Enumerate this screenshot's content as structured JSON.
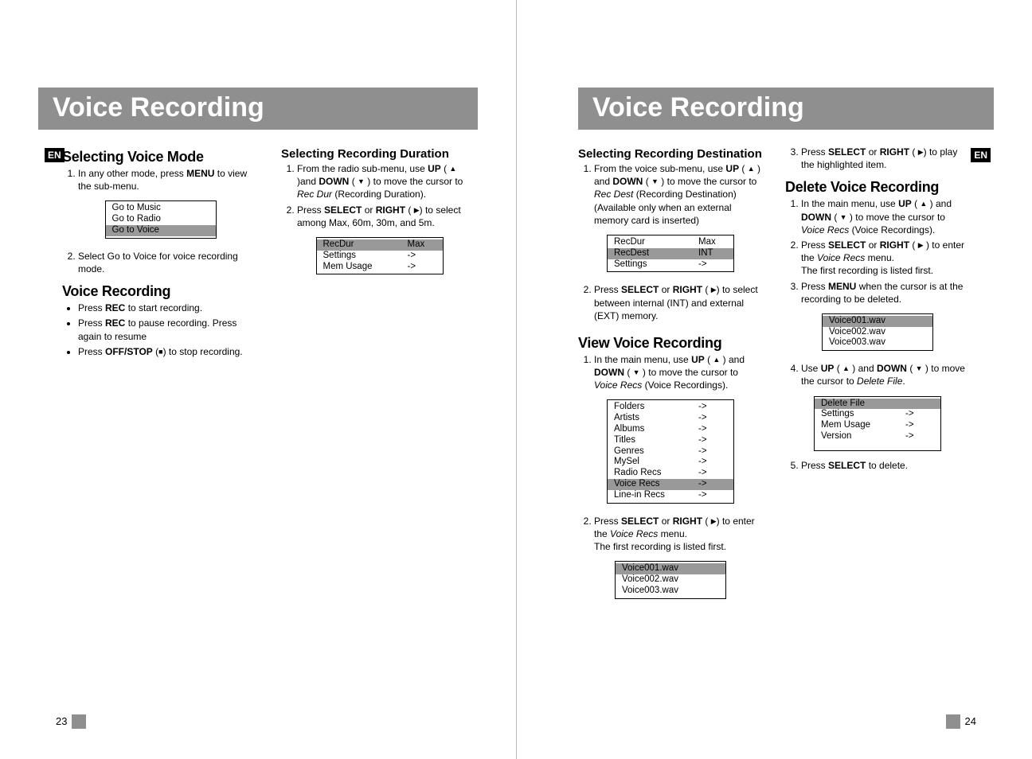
{
  "lang": "EN",
  "left": {
    "banner": "Voice Recording",
    "col1": {
      "h1": "Selecting Voice Mode",
      "s1_1a": "In any other mode, press ",
      "s1_1b": "MENU",
      "s1_1c": " to view the sub-menu.",
      "menu1": [
        "Go to Music",
        "Go to Radio",
        "Go to Voice"
      ],
      "menu1_sel": 2,
      "s1_2": "Select Go to Voice for voice recording mode.",
      "h2": "Voice Recording",
      "b1a": "Press ",
      "b1b": "REC",
      "b1c": " to start recording.",
      "b2a": "Press ",
      "b2b": "REC",
      "b2c": " to pause recording. Press again to resume",
      "b3a": "Press ",
      "b3b": "OFF/STOP",
      "b3c": " (",
      "b3d": "■",
      "b3e": ")  to stop recording."
    },
    "col2": {
      "h1": "Selecting Recording Duration",
      "s1a": "From the radio sub-menu, use ",
      "s1b": "UP",
      "s1c": " ( ",
      "s1d": "▲",
      "s1e": " )and ",
      "s1f": "DOWN",
      "s1g": " ( ",
      "s1h": "▼",
      "s1i": " ) to move the cursor to ",
      "s1j": "Rec Dur",
      "s1k": " (Recording Duration).",
      "s2a": "Press ",
      "s2b": "SELECT",
      "s2c": " or ",
      "s2d": "RIGHT",
      "s2e": " ( ",
      "s2f": "▶",
      "s2g": ") to select among Max, 60m, 30m, and 5m.",
      "menu2": [
        [
          "RecDur",
          "Max"
        ],
        [
          "Settings",
          "->"
        ],
        [
          "Mem Usage",
          "->"
        ]
      ],
      "menu2_sel": 0
    },
    "pageNum": "23"
  },
  "right": {
    "banner": "Voice Recording",
    "col1": {
      "h1": "Selecting Recording Destination",
      "s1a": "From the voice sub-menu, use",
      "s1b": "UP",
      "s1c": " ( ",
      "s1d": "▲",
      "s1e": " ) and ",
      "s1f": "DOWN",
      "s1g": " ( ",
      "s1h": "▼",
      "s1i": " ) to move the cursor to ",
      "s1j": "Rec Dest",
      "s1k": " (Recording Destination) (Available only when an external memory card is inserted)",
      "menu1": [
        [
          "RecDur",
          "Max"
        ],
        [
          "RecDest",
          "INT"
        ],
        [
          "Settings",
          "->"
        ]
      ],
      "menu1_sel": 1,
      "s2a": "Press ",
      "s2b": "SELECT",
      "s2c": " or ",
      "s2d": "RIGHT",
      "s2e": " ( ",
      "s2f": "▶",
      "s2g": ") to select between internal (INT) and external (EXT) memory.",
      "h2": "View Voice Recording",
      "v1a": "In the main menu, use ",
      "v1b": "UP",
      "v1c": " ( ",
      "v1d": "▲",
      "v1e": " ) and ",
      "v1f": "DOWN",
      "v1g": " ( ",
      "v1h": "▼",
      "v1i": " ) to move the cursor to ",
      "v1j": "Voice Recs",
      "v1k": " (Voice Recordings).",
      "menu2": [
        [
          "Folders",
          "->"
        ],
        [
          "Artists",
          "->"
        ],
        [
          "Albums",
          "->"
        ],
        [
          "Titles",
          "->"
        ],
        [
          "Genres",
          "->"
        ],
        [
          "MySel",
          "->"
        ],
        [
          "Radio Recs",
          "->"
        ],
        [
          "Voice Recs",
          "->"
        ],
        [
          "Line-in Recs",
          "->"
        ]
      ],
      "menu2_sel": 7,
      "v2a": "Press ",
      "v2b": "SELECT",
      "v2c": " or ",
      "v2d": "RIGHT",
      "v2e": " ( ",
      "v2f": "▶",
      "v2g": ") to enter the ",
      "v2h": "Voice Recs",
      "v2i": " menu.",
      "v2j": "The first recording is listed first.",
      "menu3": [
        "Voice001.wav",
        "Voice002.wav",
        "Voice003.wav"
      ],
      "menu3_sel": 0
    },
    "col2": {
      "s3a": "Press ",
      "s3b": "SELECT",
      "s3c": " or ",
      "s3d": "RIGHT",
      "s3e": " ( ",
      "s3f": "▶",
      "s3g": ") to play the highlighted item.",
      "h1": "Delete Voice Recording",
      "d1a": "In the main menu, use ",
      "d1b": "UP",
      "d1c": " ( ",
      "d1d": "▲",
      "d1e": " ) and ",
      "d1f": "DOWN",
      "d1g": " ( ",
      "d1h": "▼",
      "d1i": " ) to move the cursor to ",
      "d1j": "Voice Recs",
      "d1k": " (Voice Recordings).",
      "d2a": "Press ",
      "d2b": "SELECT",
      "d2c": " or ",
      "d2d": "RIGHT",
      "d2e": " ( ",
      "d2f": "▶",
      "d2g": " ) to enter the ",
      "d2h": "Voice Recs",
      "d2i": " menu.",
      "d2j": "The first recording is listed first.",
      "d3a": "Press ",
      "d3b": "MENU",
      "d3c": " when the cursor is at the recording to be deleted.",
      "menu1": [
        "Voice001.wav",
        "Voice002.wav",
        "Voice003.wav"
      ],
      "menu1_sel": 0,
      "d4a": "Use ",
      "d4b": "UP",
      "d4c": " ( ",
      "d4d": "▲",
      "d4e": " ) and ",
      "d4f": "DOWN",
      "d4g": " ( ",
      "d4h": "▼",
      "d4i": " ) to move the cursor to ",
      "d4j": "Delete File",
      "d4k": ".",
      "menu2": [
        [
          "Delete File",
          ""
        ],
        [
          "Settings",
          "->"
        ],
        [
          "Mem Usage",
          "->"
        ],
        [
          "Version",
          "->"
        ]
      ],
      "menu2_sel": 0,
      "d5a": "Press ",
      "d5b": "SELECT",
      "d5c": " to delete."
    },
    "pageNum": "24"
  }
}
